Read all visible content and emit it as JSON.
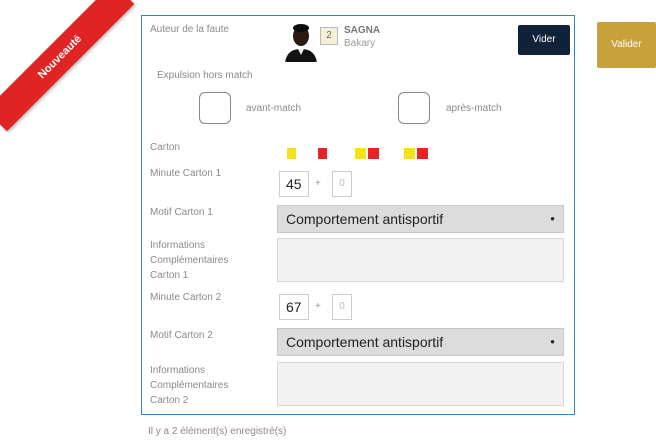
{
  "ribbon": {
    "label": "Nouveauté",
    "color": "#e02424"
  },
  "form": {
    "author_label": "Auteur de la faute",
    "player": {
      "number": "2",
      "last_name": "SAGNA",
      "first_name": "Bakary"
    },
    "clear_label": "Vider",
    "validate_label": "Valider",
    "expulsion_label": "Expulsion hors match",
    "before_match_label": "avant-match",
    "after_match_label": "après-match",
    "card_label": "Carton",
    "card_options": [
      {
        "icon": "yellow-card-icon"
      },
      {
        "icon": "red-card-icon"
      },
      {
        "icon": "yellow-red-card-icon"
      },
      {
        "icon": "yellow-red-card-icon"
      }
    ],
    "card1": {
      "minute_label": "Minute Carton 1",
      "minute_value": "45",
      "plus": "+",
      "extra_value": "0",
      "reason_label": "Motif Carton 1",
      "reason_value": "Comportement antisportif",
      "info_label_1": "Informations",
      "info_label_2": "Complémentaires",
      "info_label_3": "Carton 1"
    },
    "card2": {
      "minute_label": "Minute Carton 2",
      "minute_value": "67",
      "plus": "+",
      "extra_value": "0",
      "reason_label": "Motif Carton 2",
      "reason_value": "Comportement antisportif",
      "info_label_1": "Informations",
      "info_label_2": "Complémentaires",
      "info_label_3": "Carton 2"
    }
  },
  "footer": {
    "text": "Il y a 2 élément(s) enregistré(s)"
  },
  "colors": {
    "panel_border": "#3b82c4",
    "clear_button": "#0f2238",
    "validate_button": "#c9a13b"
  }
}
